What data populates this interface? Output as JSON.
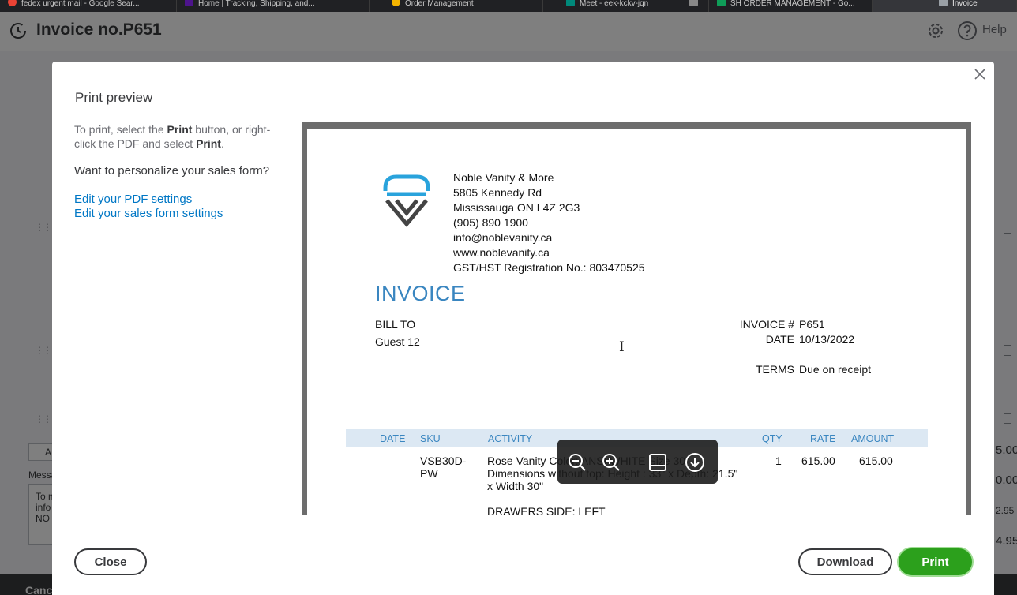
{
  "browser": {
    "tabs": [
      {
        "label": "fedex urgent mail - Google Sear...",
        "color": "#ea4335"
      },
      {
        "label": "Home | Tracking, Shipping, and...",
        "color": "#4d148c"
      },
      {
        "label": "Order Management",
        "color": "#f4b400"
      },
      {
        "label": "Meet - eek-kckv-jqn",
        "color": "#00897b"
      },
      {
        "label": "",
        "color": "#888888"
      },
      {
        "label": "SH ORDER MANAGEMENT - Go...",
        "color": "#0f9d58"
      },
      {
        "label": "Invoice",
        "color": "#9aa0a6"
      }
    ]
  },
  "header": {
    "title": "Invoice no.P651",
    "help_label": "Help"
  },
  "background": {
    "cancel_label": "Cancel",
    "amounts": [
      "5.00",
      "0.00",
      "2.95",
      "4.95"
    ],
    "message_label": "Messa",
    "message_text": [
      "To m",
      "info",
      "NO"
    ],
    "button_fragment": "A"
  },
  "modal": {
    "title": "Print preview",
    "instructions_prefix": "To print, select the ",
    "instructions_print1": "Print",
    "instructions_mid": " button, or right-click the PDF and select ",
    "instructions_print2": "Print",
    "instructions_end": ".",
    "personalize": "Want to personalize your sales form?",
    "link_pdf": "Edit your PDF settings",
    "link_sales_form": "Edit your sales form settings",
    "close_label": "Close",
    "download_label": "Download",
    "print_label": "Print"
  },
  "invoice": {
    "company_name": "Noble Vanity & More",
    "address1": "5805 Kennedy Rd",
    "address2": "Mississauga ON  L4Z 2G3",
    "phone": "(905) 890 1900",
    "email": "info@noblevanity.ca",
    "website": "www.noblevanity.ca",
    "tax_reg": "GST/HST Registration No.: 803470525",
    "heading": "INVOICE",
    "bill_to_label": "BILL TO",
    "bill_to_name": "Guest 12",
    "invoice_no_label": "INVOICE #",
    "invoice_no": "P651",
    "date_label": "DATE",
    "date": "10/13/2022",
    "terms_label": "TERMS",
    "terms": "Due on receipt",
    "columns": [
      "DATE",
      "SKU",
      "ACTIVITY",
      "QTY",
      "RATE",
      "AMOUNT"
    ],
    "line": {
      "sku_1": "VSB30D-",
      "sku_2": "PW",
      "activity_1": "Rose Vanity Color: ANSI WHITE Size 30\"",
      "activity_2": "Dimensions without top: Height : 33\" x Depth: 21.5\"",
      "activity_3": "x Width 30\"",
      "activity_4": "DRAWERS SIDE: LEFT",
      "qty": "1",
      "rate": "615.00",
      "amount": "615.00"
    }
  },
  "pdf_toolbar": {
    "icons": [
      "zoom-out-icon",
      "zoom-in-icon",
      "fit-page-icon",
      "download-icon"
    ]
  },
  "colors": {
    "print_green": "#2ca01c",
    "link_blue": "#0077c5",
    "invoice_blue": "#3a86c0",
    "header_band": "#dce8f3"
  }
}
